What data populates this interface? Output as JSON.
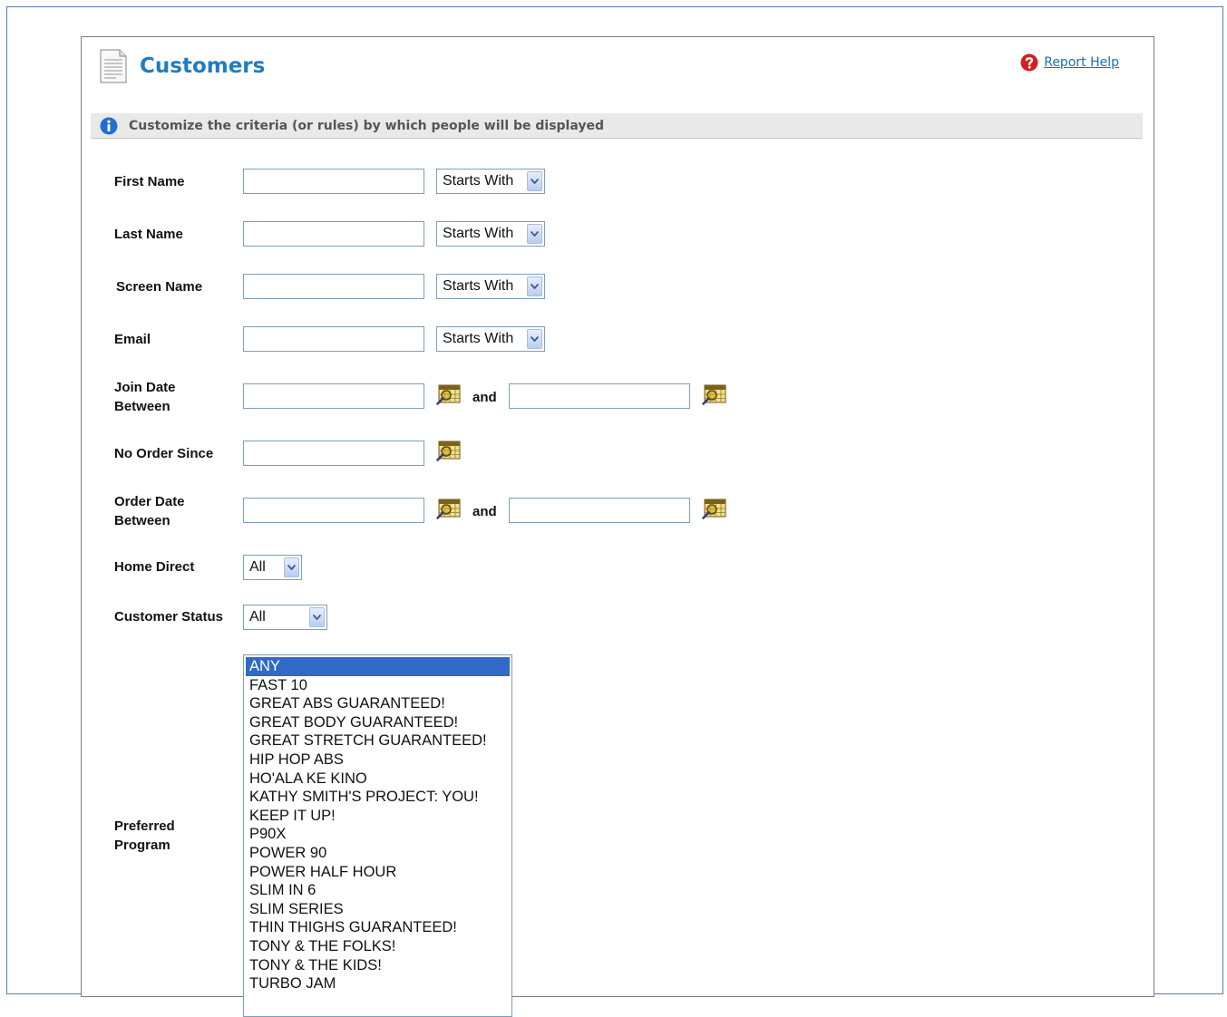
{
  "header": {
    "title": "Customers",
    "help_link": "Report Help"
  },
  "info_bar": {
    "text": "Customize the criteria (or rules) by which people will be displayed"
  },
  "fields": {
    "first_name": {
      "label": "First Name",
      "value": "",
      "operator": "Starts With"
    },
    "last_name": {
      "label": "Last Name",
      "value": "",
      "operator": "Starts With"
    },
    "screen_name": {
      "label": "Screen Name",
      "value": "",
      "operator": "Starts With"
    },
    "email": {
      "label": "Email",
      "value": "",
      "operator": "Starts With"
    },
    "join_date": {
      "label_line1": "Join Date",
      "label_line2": "Between",
      "from": "",
      "to": "",
      "and_label": "and"
    },
    "no_order_since": {
      "label": "No Order Since",
      "value": ""
    },
    "order_date": {
      "label_line1": "Order Date",
      "label_line2": "Between",
      "from": "",
      "to": "",
      "and_label": "and"
    },
    "home_direct": {
      "label": "Home Direct",
      "selected": "All"
    },
    "customer_status": {
      "label": "Customer Status",
      "selected": "All"
    },
    "preferred_program": {
      "label_line1": "Preferred",
      "label_line2": "Program",
      "selected_index": 0,
      "options": [
        "ANY",
        "FAST 10",
        "GREAT ABS GUARANTEED!",
        "GREAT BODY GUARANTEED!",
        "GREAT STRETCH GUARANTEED!",
        "HIP HOP ABS",
        "HO'ALA KE KINO",
        "KATHY SMITH'S PROJECT: YOU!",
        "KEEP IT UP!",
        "P90X",
        "POWER 90",
        "POWER HALF HOUR",
        "SLIM IN 6",
        "SLIM SERIES",
        "THIN THIGHS GUARANTEED!",
        "TONY & THE FOLKS!",
        "TONY & THE KIDS!",
        "TURBO JAM"
      ]
    }
  },
  "icons": {
    "page": "document-icon",
    "help": "help-icon",
    "info": "info-icon",
    "calendar": "calendar-icon"
  },
  "colors": {
    "title": "#1f7cc2",
    "link": "#1a6fb8",
    "selection": "#3169c6",
    "help_icon": "#d42020",
    "info_icon": "#1f6fd0"
  }
}
